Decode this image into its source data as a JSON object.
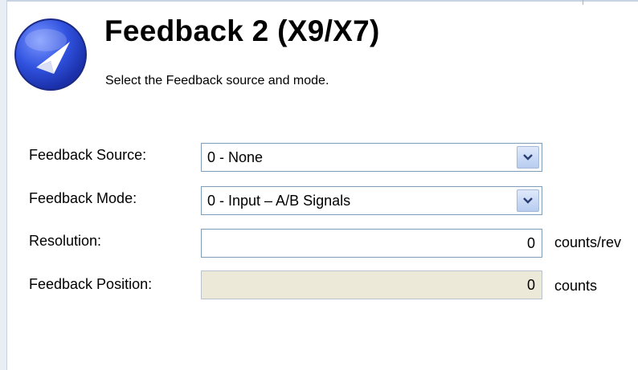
{
  "header": {
    "title": "Feedback 2 (X9/X7)",
    "subtitle": "Select the Feedback source and mode."
  },
  "form": {
    "feedback_source": {
      "label": "Feedback Source:",
      "value": "0 - None"
    },
    "feedback_mode": {
      "label": "Feedback Mode:",
      "value": "0 - Input – A/B Signals"
    },
    "resolution": {
      "label": "Resolution:",
      "value": "0",
      "unit": "counts/rev"
    },
    "feedback_position": {
      "label": "Feedback Position:",
      "value": "0",
      "unit": "counts"
    }
  },
  "icons": {
    "logo": "compass-arrow-icon",
    "dropdown": "chevron-down-icon"
  },
  "colors": {
    "logo_blue": "#2f4fd8",
    "field_border": "#7f9db9",
    "disabled_bg": "#ece9d8"
  }
}
